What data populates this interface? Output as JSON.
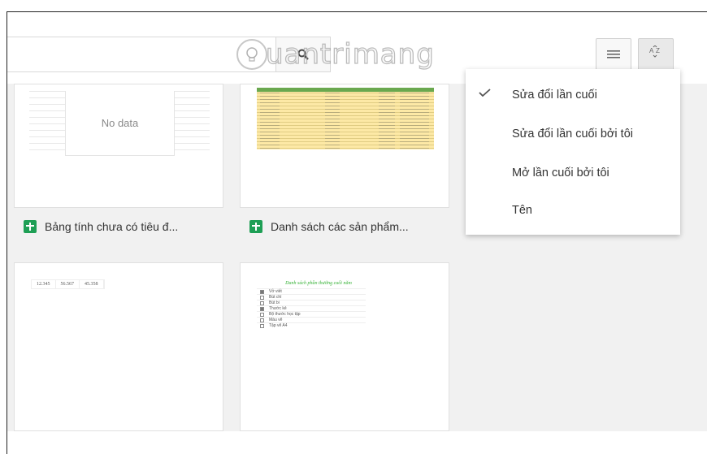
{
  "toolbar": {
    "search_placeholder": "",
    "search_icon": "search-icon",
    "list_view_icon": "list-view-icon",
    "sort_icon": "sort-az-icon"
  },
  "files": [
    {
      "name": "Bảng tính chưa có tiêu đ...",
      "icon": "google-sheets-icon",
      "preview_text": "No data"
    },
    {
      "name": "Danh sách các sản phẩm...",
      "icon": "google-sheets-icon"
    },
    {
      "name": "",
      "preview_numbers": [
        "12.345",
        "56.567",
        "45.358"
      ]
    },
    {
      "name": "",
      "preview_title": "Danh sách phần thưởng cuối năm",
      "preview_items": [
        "Vở viết",
        "Bút chì",
        "Bút bi",
        "Thước kẻ",
        "Bộ thước học tập",
        "Màu vẽ",
        "Tập vẽ A4"
      ]
    }
  ],
  "sort_menu": {
    "items": [
      {
        "label": "Sửa đổi lần cuối",
        "checked": true
      },
      {
        "label": "Sửa đổi lần cuối bởi tôi",
        "checked": false
      },
      {
        "label": "Mở lần cuối bởi tôi",
        "checked": false
      },
      {
        "label": "Tên",
        "checked": false
      }
    ]
  },
  "watermark": {
    "text": "uantrimang"
  },
  "colors": {
    "sheets_green": "#1e9f55",
    "grid_bg": "#f1f1f1",
    "menu_text": "#333333"
  }
}
